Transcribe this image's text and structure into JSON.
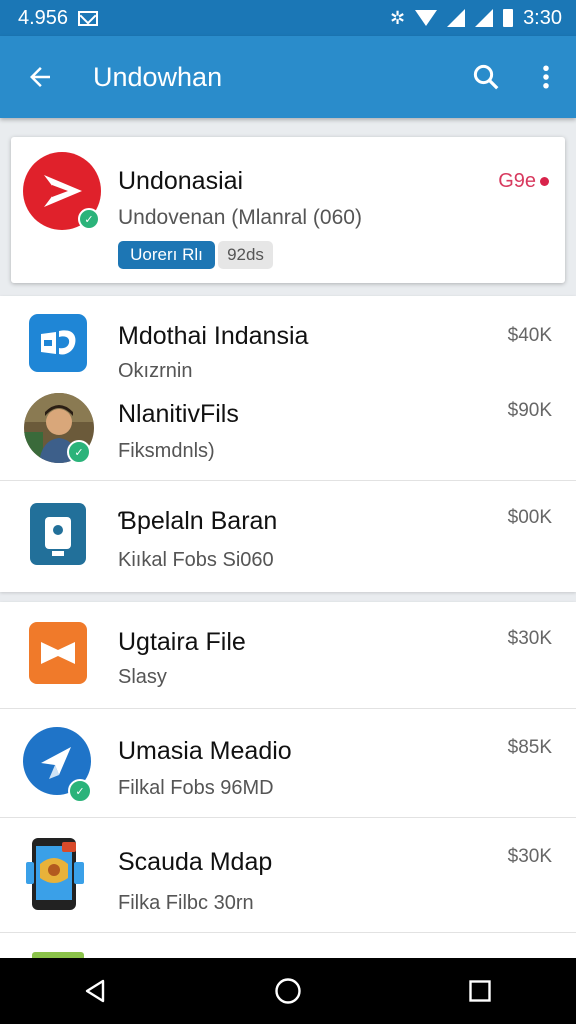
{
  "status_bar": {
    "time_left": "4.956",
    "time_right": "3:30"
  },
  "app_bar": {
    "title": "Undowhan"
  },
  "featured": {
    "title": "Undonasiai",
    "subtitle": "Undovenan (Mlanral (060)",
    "chip_primary": "Uorerı Rlı",
    "chip_secondary": "92ds",
    "price": "G9e",
    "accent": "#d83a5f"
  },
  "group1": [
    {
      "title": "Mdothai Indansia",
      "subtitle": "Okızrnin",
      "price": "$40K",
      "icon": "windows-store-icon"
    },
    {
      "title": "NlanitivFils",
      "subtitle": "Fiksmdnls)",
      "price": "$90K",
      "icon": "person-avatar"
    }
  ],
  "group2": [
    {
      "title": "Ɓpelaln Baran",
      "subtitle": "Kiıkal Fobs Si060",
      "price": "$00K",
      "icon": "blue-doc-icon"
    }
  ],
  "group3": [
    {
      "title": "Ugtaira File",
      "subtitle": "Slasy",
      "price": "$30K",
      "icon": "orange-ribbon-icon"
    },
    {
      "title": "Umasia Meadio",
      "subtitle": "Filkal Fobs 96MD",
      "price": "$85K",
      "icon": "blue-paperplane-icon"
    },
    {
      "title": "Scauda Mdap",
      "subtitle": "Filka Filbc 30rn",
      "price": "$30K",
      "icon": "phone-map-icon"
    }
  ],
  "colors": {
    "status_bar": "#1b77b6",
    "app_bar": "#2a8ccb",
    "check": "#2bb37a"
  }
}
